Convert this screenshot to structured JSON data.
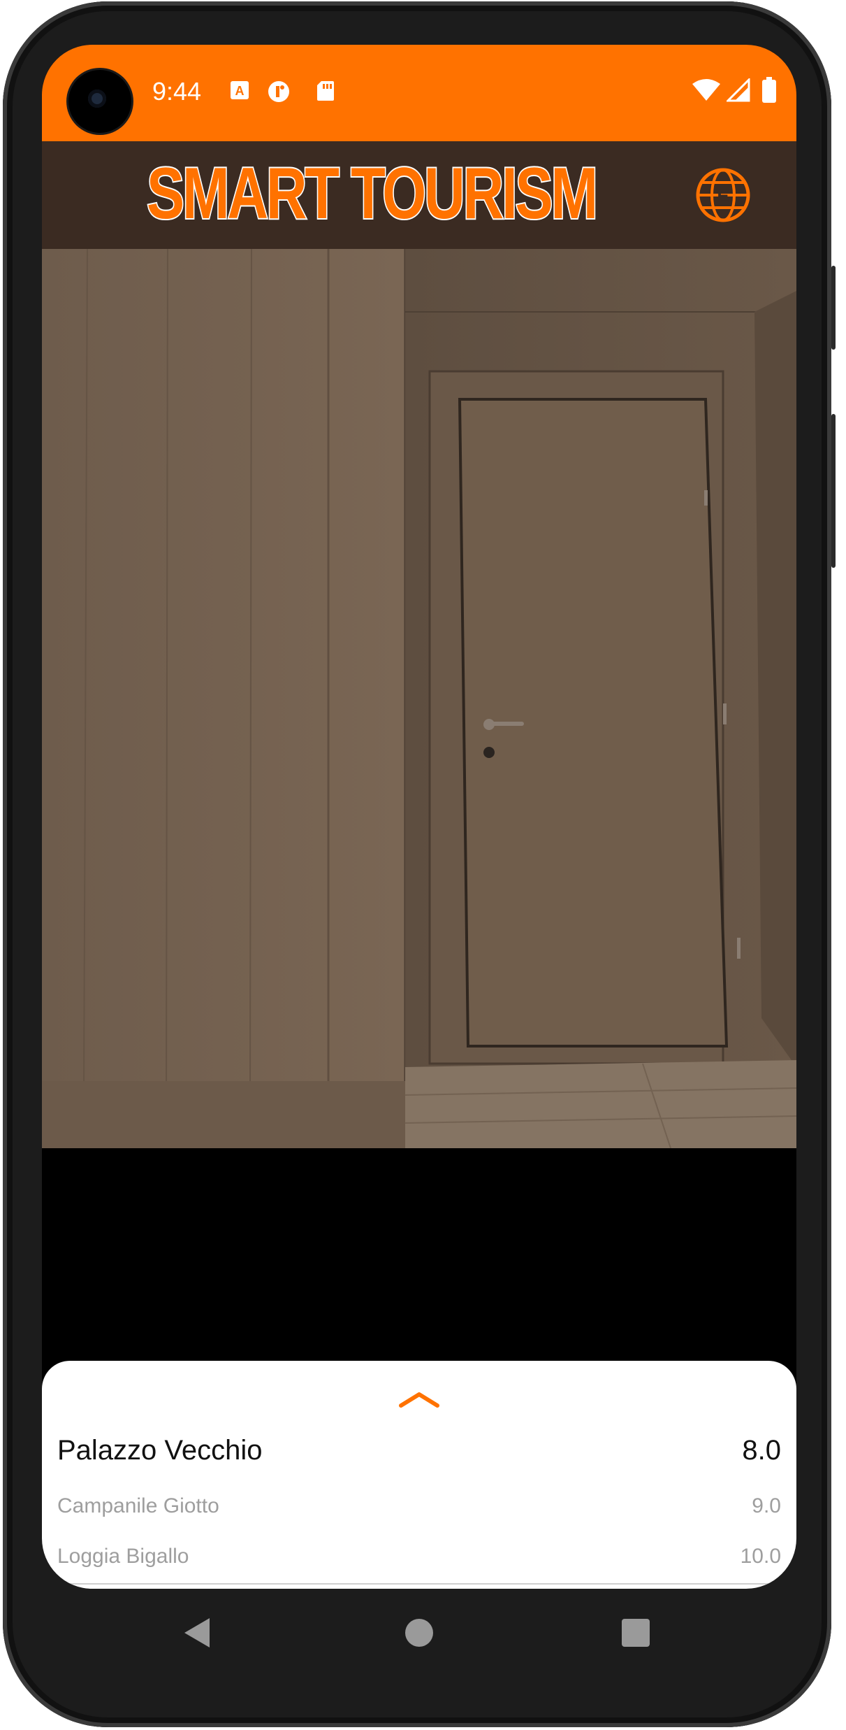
{
  "status_bar": {
    "time": "9:44",
    "left_icons": [
      "font-icon",
      "info-circle-icon",
      "sd-card-icon"
    ],
    "right_icons": [
      "wifi-icon",
      "signal-icon",
      "battery-icon"
    ]
  },
  "header": {
    "logo_text": "SMART TOURISM",
    "language_icon": "globe-icon"
  },
  "colors": {
    "accent": "#ff7200",
    "header_bg": "#3b2b22",
    "sheet_bg": "#ffffff",
    "primary_text": "#111111",
    "secondary_text": "#9e9e9e"
  },
  "sheet": {
    "expand_icon": "chevron-up-icon",
    "top_result": {
      "name": "Palazzo Vecchio",
      "score": "8.0"
    },
    "others": [
      {
        "name": "Campanile Giotto",
        "score": "9.0"
      },
      {
        "name": "Loggia Bigallo",
        "score": "10.0"
      }
    ]
  },
  "nav_bar": {
    "back_icon": "back-triangle-icon",
    "home_icon": "home-circle-icon",
    "recents_icon": "recents-square-icon"
  }
}
